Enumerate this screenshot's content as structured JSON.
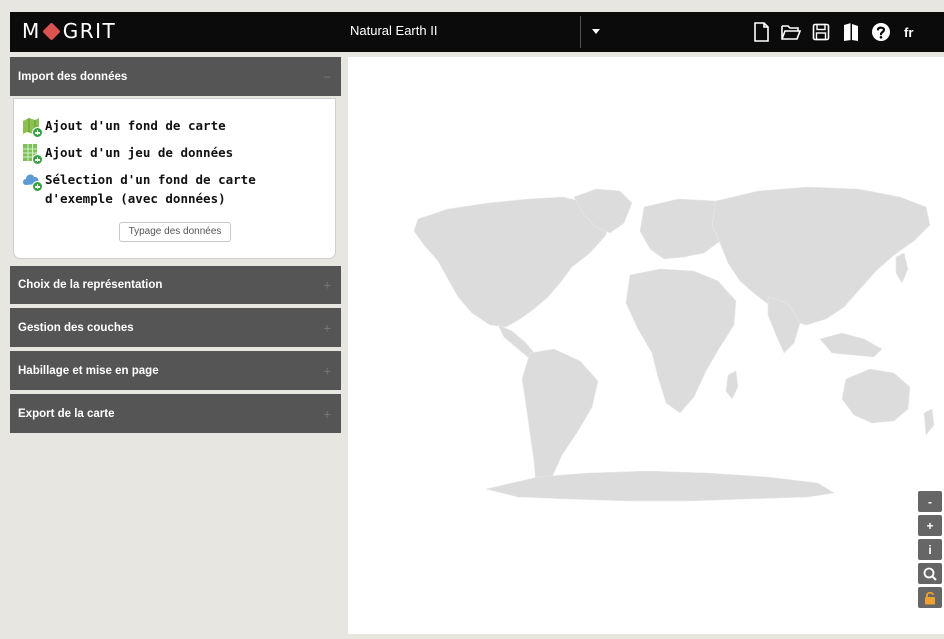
{
  "app": {
    "logo": "M◆GRIT",
    "logo_left": "M",
    "logo_right": "GRIT"
  },
  "project": {
    "name": "Natural Earth II"
  },
  "toolbar": {
    "icons": [
      "new-file-icon",
      "open-folder-icon",
      "save-icon",
      "documentation-icon",
      "help-icon"
    ],
    "language": "fr"
  },
  "panel": {
    "import": {
      "title": "Import des données",
      "toggle": "−",
      "items": [
        {
          "label": "Ajout d'un fond de carte",
          "icon": "add-basemap-icon"
        },
        {
          "label": "Ajout d'un jeu de données",
          "icon": "add-dataset-icon"
        },
        {
          "label": "Sélection d'un fond de carte d'exemple (avec données)",
          "icon": "example-basemap-icon"
        }
      ],
      "typage_button": "Typage des données"
    },
    "sections": [
      {
        "title": "Choix de la représentation",
        "toggle": "+"
      },
      {
        "title": "Gestion des couches",
        "toggle": "+"
      },
      {
        "title": "Habillage et mise en page",
        "toggle": "+"
      },
      {
        "title": "Export de la carte",
        "toggle": "+"
      }
    ]
  },
  "map_controls": [
    {
      "label": "-",
      "icon": "zoom-out-icon"
    },
    {
      "label": "+",
      "icon": "zoom-in-icon"
    },
    {
      "label": "i",
      "icon": "info-icon"
    },
    {
      "label": "",
      "icon": "zoom-extent-icon"
    },
    {
      "label": "",
      "icon": "lock-icon"
    }
  ],
  "colors": {
    "topbar": "#0b0b0b",
    "panel_header": "#555555",
    "land": "#dcdcdc",
    "accent": "#d9534f",
    "lock": "#f0a030"
  }
}
